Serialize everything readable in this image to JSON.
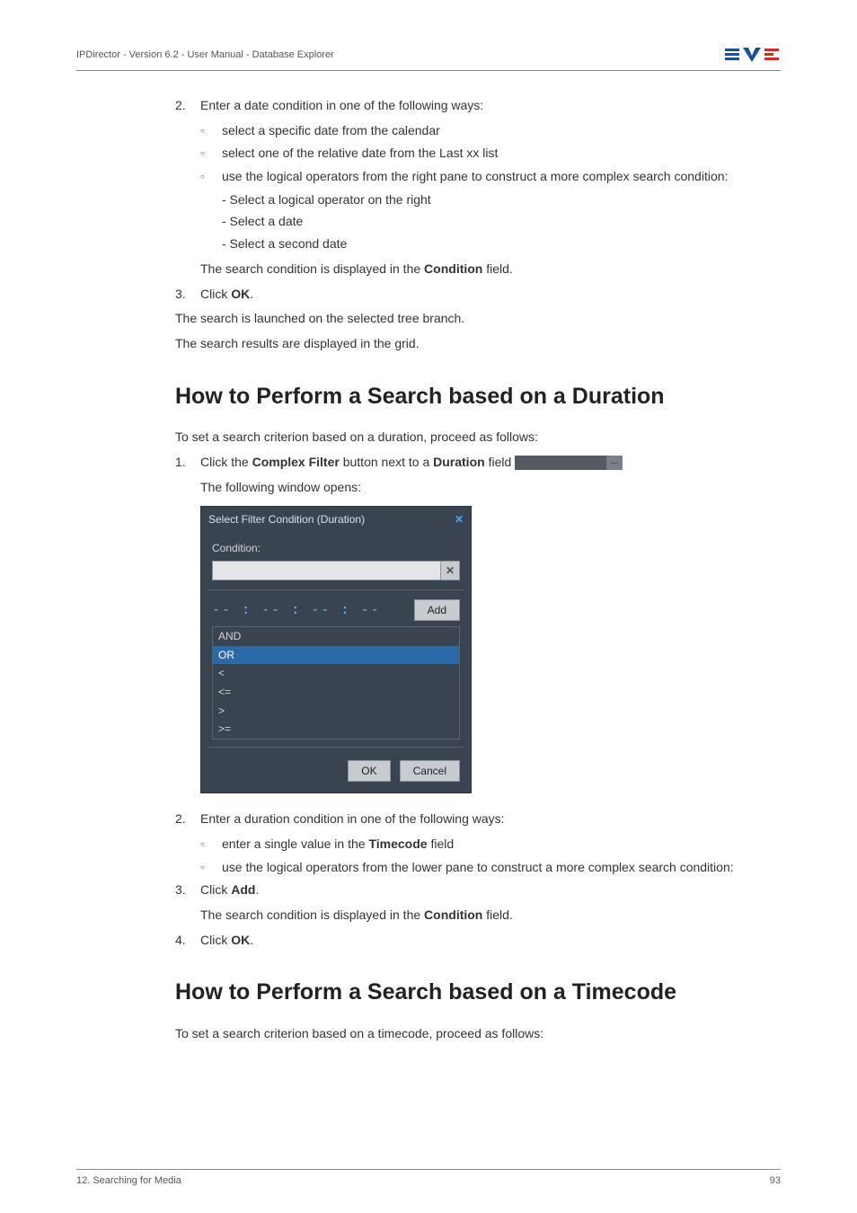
{
  "header": {
    "breadcrumb": "IPDirector - Version 6.2 - User Manual - Database Explorer"
  },
  "s2": {
    "num": "2.",
    "intro": "Enter a date condition in one of the following ways:",
    "b1": "select a specific date from the calendar",
    "b2": "select one of the relative date from the Last xx list",
    "b3": "use the logical operators from the right pane to construct a more complex search condition:",
    "d1": "- Select a logical operator on the right",
    "d2": "- Select a date",
    "d3": "- Select a second date",
    "cond_pre": "The search condition is displayed in the ",
    "cond_bold": "Condition",
    "cond_post": " field."
  },
  "s3": {
    "num": "3.",
    "pre": "Click ",
    "bold": "OK",
    "post": "."
  },
  "after3": {
    "l1": "The search is launched on the selected tree branch.",
    "l2": "The search results are displayed in the grid."
  },
  "h_duration": "How to Perform a Search based on a Duration",
  "dur_intro": "To set a search criterion based on a duration, proceed as follows:",
  "d1": {
    "num": "1.",
    "pre": "Click the ",
    "b1": "Complex Filter",
    "mid": " button next to a ",
    "b2": "Duration",
    "post": " field ",
    "dots": "...",
    "open": "The following window opens:"
  },
  "dialog": {
    "title": "Select Filter Condition (Duration)",
    "close": "✕",
    "cond_label": "Condition:",
    "clear": "✕",
    "tc": "-- : -- : -- : --",
    "add": "Add",
    "ops": [
      "AND",
      "OR",
      "<",
      "<=",
      ">",
      ">="
    ],
    "ok": "OK",
    "cancel": "Cancel"
  },
  "d2": {
    "num": "2.",
    "intro": "Enter a duration condition in one of the following ways:",
    "b1_pre": "enter a single value in the ",
    "b1_bold": "Timecode",
    "b1_post": " field",
    "b2": "use the logical operators from the lower pane to construct a more complex search condition:"
  },
  "d3": {
    "num": "3.",
    "pre": "Click ",
    "bold": "Add",
    "post": ".",
    "cond_pre": "The search condition is displayed in the ",
    "cond_bold": "Condition",
    "cond_post": " field."
  },
  "d4": {
    "num": "4.",
    "pre": "Click ",
    "bold": "OK",
    "post": "."
  },
  "h_timecode": "How to Perform a Search based on a Timecode",
  "tc_intro": "To set a search criterion based on a timecode, proceed as follows:",
  "footer": {
    "left": "12. Searching for Media",
    "right": "93"
  }
}
